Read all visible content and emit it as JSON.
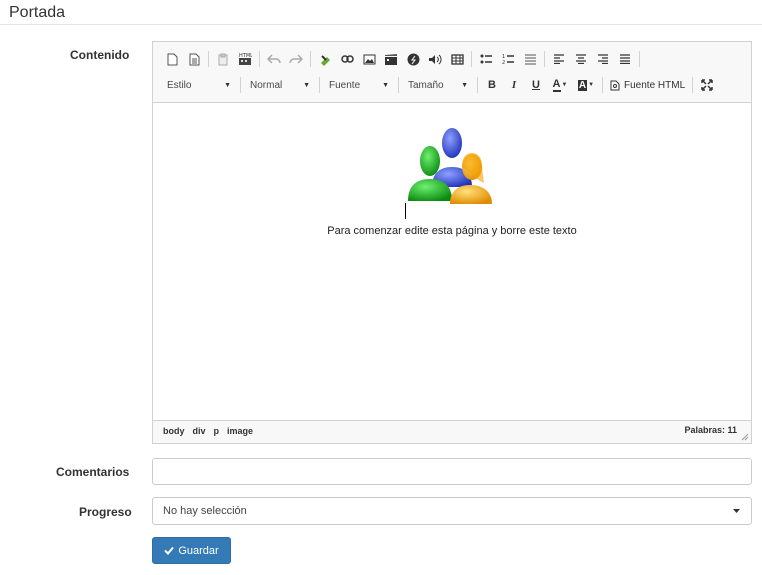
{
  "page": {
    "title": "Portada"
  },
  "form": {
    "content_label": "Contenido",
    "comments_label": "Comentarios",
    "comments_value": "",
    "progress_label": "Progreso",
    "progress_selected": "No hay selección",
    "save_label": "Guardar"
  },
  "editor": {
    "toolbar": {
      "row1_icons": [
        "new-page-icon",
        "templates-icon",
        "paste-icon",
        "paste-word-icon",
        "undo-icon",
        "redo-icon",
        "anchor-icon",
        "link-icon",
        "image-icon",
        "video-icon",
        "flash-icon",
        "audio-icon",
        "table-icon",
        "bulleted-list-icon",
        "numbered-list-icon",
        "horizontal-rule-icon",
        "align-left-icon",
        "align-center-icon",
        "align-right-icon",
        "justify-icon"
      ],
      "style_combo": "Estilo",
      "format_combo": "Normal",
      "font_combo": "Fuente",
      "size_combo": "Tamaño",
      "bold": "B",
      "italic": "I",
      "underline": "U",
      "text_color": "A",
      "bg_color": "A",
      "source_label": "Fuente HTML"
    },
    "body_text": "Para comenzar edite esta página y borre este texto",
    "path": [
      "body",
      "div",
      "p",
      "image"
    ],
    "word_count": "Palabras: 11"
  },
  "colors": {
    "primary": "#337ab7",
    "border": "#d1d1d1",
    "toolbar_bg": "#f8f8f8"
  }
}
